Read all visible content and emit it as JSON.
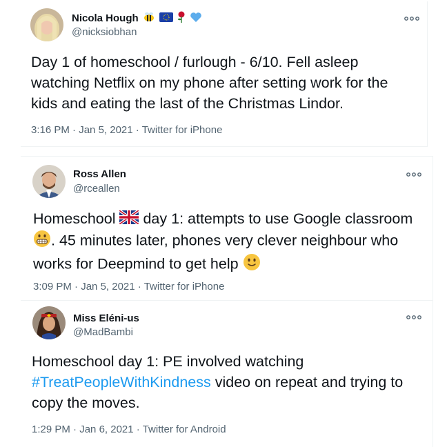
{
  "tweets": [
    {
      "name": "Nicola Hough",
      "handle": "@nicksiobhan",
      "name_emojis": [
        "bee-icon",
        "eu-flag-icon",
        "rose-icon",
        "blue-heart-icon"
      ],
      "lines": [
        "Day 1 of homeschool / furlough - 6/10. Fell asleep",
        "watching Netflix on my phone after setting work for the",
        "kids and eating the last of the Christmas Lindor."
      ],
      "time": "3:16 PM",
      "date": "Jan 5, 2021",
      "source": "Twitter for iPhone"
    },
    {
      "name": "Ross Allen",
      "handle": "@rceallen",
      "line1_a": "Homeschool",
      "line1_b": "day 1: attempts to use Google classroom",
      "line2": ". 45 minutes later, phones very clever neighbour who",
      "line3": "works for Deepmind to get help",
      "time": "3:09 PM",
      "date": "Jan 5, 2021",
      "source": "Twitter for iPhone"
    },
    {
      "name": "Miss Eléni-us",
      "handle": "@MadBambi",
      "line1": "Homeschool day 1: PE involved watching",
      "hashtag": "#TreatPeopleWithKindness",
      "line2_rest": " video on repeat and trying to",
      "line3": "copy the moves.",
      "time": "1:29 PM",
      "date": "Jan 6, 2021",
      "source": "Twitter for Android"
    }
  ],
  "separator": "·",
  "colors": {
    "text": "#0f1419",
    "secondary": "#536471",
    "link": "#1d9bf0"
  }
}
